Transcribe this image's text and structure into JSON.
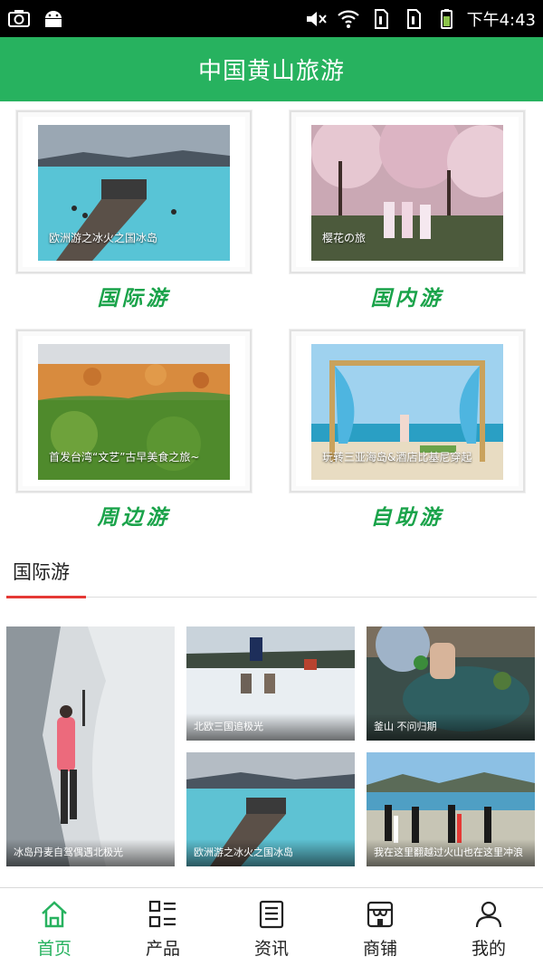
{
  "status_bar": {
    "time": "下午4:43",
    "icons": [
      "camera-icon",
      "android-icon",
      "mute-icon",
      "wifi-icon",
      "sim1-icon",
      "sim2-icon",
      "battery-icon"
    ]
  },
  "header": {
    "title": "中国黄山旅游"
  },
  "categories": [
    {
      "label": "国际游",
      "caption": "欧洲游之冰火之国冰岛"
    },
    {
      "label": "国内游",
      "caption": "樱花の旅"
    },
    {
      "label": "周边游",
      "caption": "首发台湾“文艺”古早美食之旅~"
    },
    {
      "label": "自助游",
      "caption": "玩转三亚海岛&酒店比基尼穿起"
    }
  ],
  "section": {
    "title": "国际游"
  },
  "tiles": [
    {
      "caption": "冰岛丹麦自驾偶遇北极光"
    },
    {
      "caption": "北欧三国追极光"
    },
    {
      "caption": "釜山 不问归期"
    },
    {
      "caption": "欧洲游之冰火之国冰岛"
    },
    {
      "caption": "我在这里翻越过火山也在这里冲浪"
    }
  ],
  "nav": [
    {
      "label": "首页",
      "icon": "home-icon",
      "active": true
    },
    {
      "label": "产品",
      "icon": "grid-list-icon",
      "active": false
    },
    {
      "label": "资讯",
      "icon": "news-icon",
      "active": false
    },
    {
      "label": "商铺",
      "icon": "shop-icon",
      "active": false
    },
    {
      "label": "我的",
      "icon": "user-icon",
      "active": false
    }
  ],
  "colors": {
    "brand_green": "#27b25f",
    "accent_red": "#e53935",
    "status_bar": "#000000"
  }
}
